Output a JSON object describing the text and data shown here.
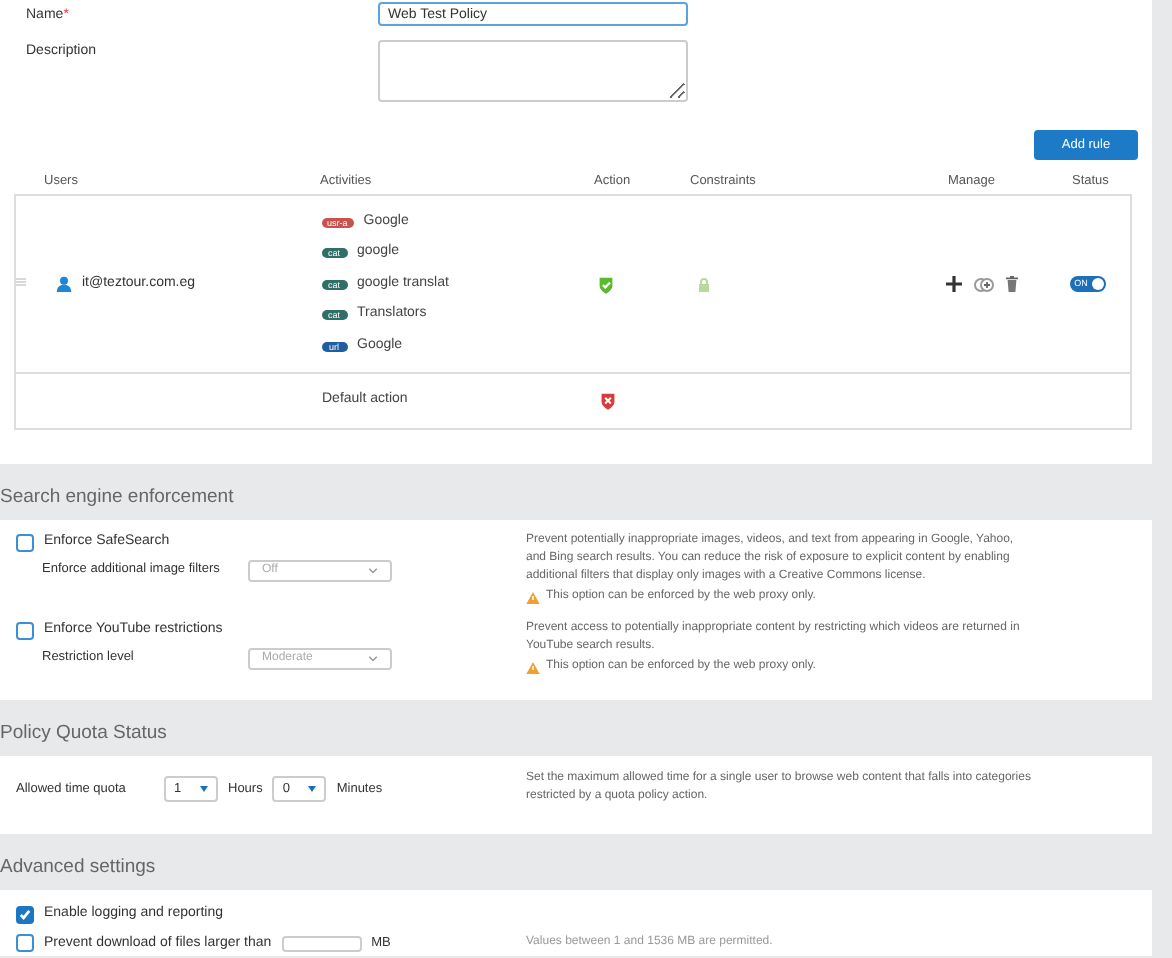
{
  "form": {
    "name": {
      "label": "Name",
      "required_mark": "*",
      "value": "Web Test Policy"
    },
    "description": {
      "label": "Description"
    },
    "add_rule_button": "Add rule"
  },
  "table": {
    "columns": [
      "Users",
      "Activities",
      "Action",
      "Constraints",
      "Manage",
      "Status"
    ],
    "rules": [
      {
        "user": "it@teztour.com.eg",
        "activities": [
          {
            "tag": "usr-a",
            "color": "#c9524f",
            "label": "Google"
          },
          {
            "tag": "cat",
            "color": "#2f6f66",
            "label": "google"
          },
          {
            "tag": "cat",
            "color": "#2f6f66",
            "label": "google translat"
          },
          {
            "tag": "cat",
            "color": "#2f6f66",
            "label": "Translators"
          },
          {
            "tag": "url",
            "color": "#1f5fa0",
            "label": "Google"
          }
        ],
        "allowed": true,
        "status": {
          "label": "ON",
          "on": true
        }
      }
    ],
    "default_row": {
      "label": "Default action",
      "allowed": false
    }
  },
  "sections": [
    {
      "title": "Search engine enforcement",
      "items": [
        {
          "label": "Enforce SafeSearch",
          "checked": false,
          "sub_label": "Enforce additional image filters",
          "select": {
            "value": "Off",
            "disabled": true
          },
          "description": "Prevent potentially inappropriate images, videos, and text from appearing in Google, Yahoo, and Bing search results. You can reduce the risk of exposure to explicit content by enabling additional filters that display only images with a Creative Commons license.",
          "warning": "This option can be enforced by the web proxy only."
        },
        {
          "label": "Enforce YouTube restrictions",
          "checked": false,
          "sub_label": "Restriction level",
          "select": {
            "value": "Moderate",
            "disabled": true
          },
          "description": "Prevent access to potentially inappropriate content by restricting which videos are returned in YouTube search results.",
          "warning": "This option can be enforced by the web proxy only."
        }
      ]
    },
    {
      "title": "Policy Quota Status",
      "quota": {
        "label": "Allowed time quota",
        "hours": "1",
        "hours_unit": "Hours",
        "minutes": "0",
        "minutes_unit": "Minutes",
        "description": "Set the maximum allowed time for a single user to browse web content that falls into categories restricted by a quota policy action."
      }
    },
    {
      "title": "Advanced settings",
      "checks": [
        {
          "label": "Enable logging and reporting",
          "checked": true
        },
        {
          "label": "Prevent download of files larger than",
          "checked": false,
          "unit": "MB",
          "description": "Values between 1 and 1536 MB are permitted."
        }
      ]
    }
  ]
}
